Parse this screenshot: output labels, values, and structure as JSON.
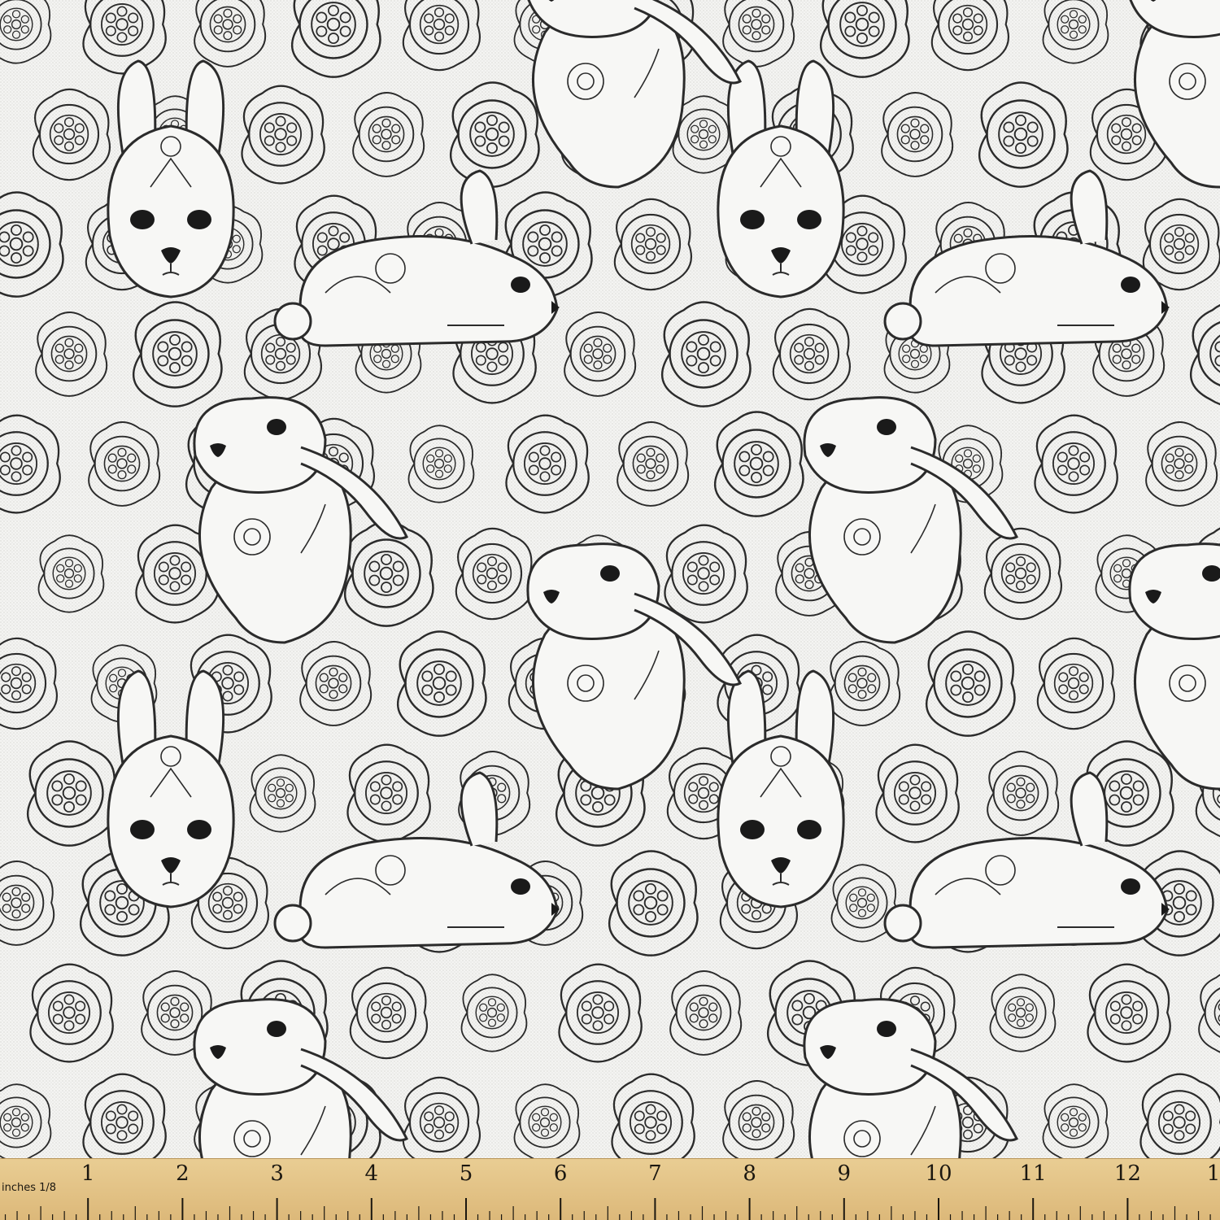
{
  "fabric": {
    "motif": "rabbit-and-flower line-art pattern",
    "background_color": "#f4f4f2",
    "line_color": "#2b2b2b"
  },
  "ruler": {
    "unit_label": "inches 1/8",
    "numbers": [
      "1",
      "2",
      "3",
      "4",
      "5",
      "6",
      "7",
      "8",
      "9",
      "10",
      "11",
      "12",
      "1"
    ],
    "color": "#e2c184",
    "tick_color": "#1b1710"
  }
}
